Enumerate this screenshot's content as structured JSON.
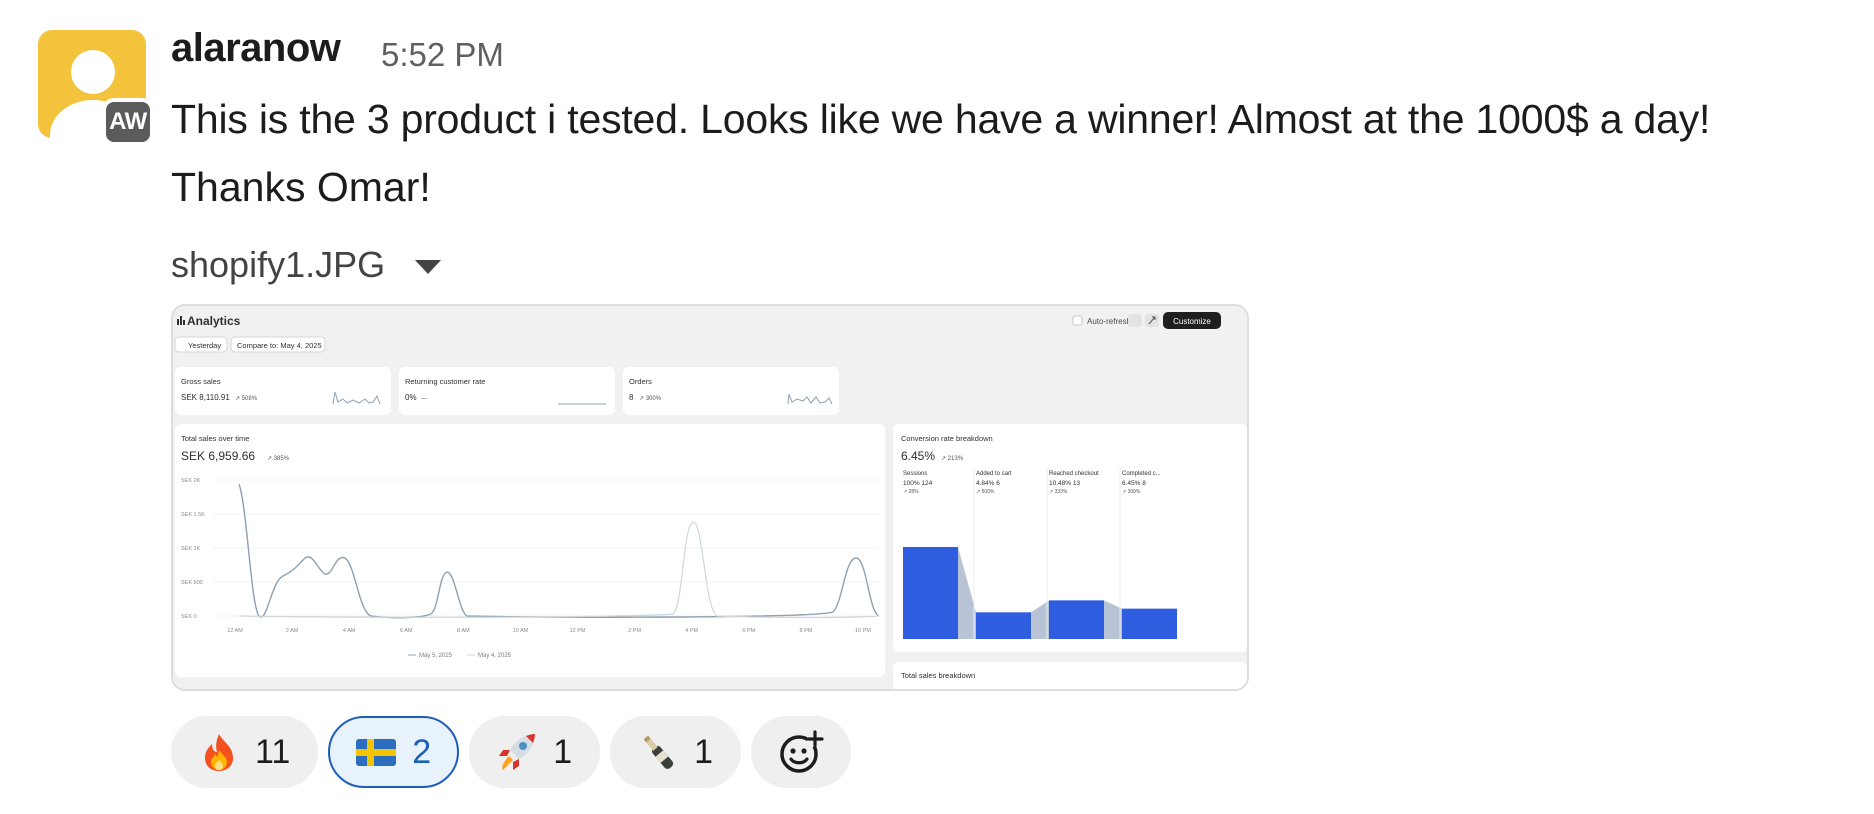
{
  "message": {
    "author": "alaranow",
    "avatar_badge": "AW",
    "timestamp": "5:52 PM",
    "text_line1": "This is the 3 product i tested. Looks like we have a winner! Almost at the 1000$ a day!",
    "text_line2": "Thanks Omar!"
  },
  "attachment": {
    "file_name": "shopify1.JPG",
    "dashboard": {
      "title": "Analytics",
      "auto_refresh": "Auto-refresh",
      "customize": "Customize",
      "date_chip": "Yesterday",
      "compare_chip": "Compare to: May 4, 2025",
      "metrics": [
        {
          "label": "Gross sales",
          "value": "SEK 8,110.91",
          "change": "↗ 508%"
        },
        {
          "label": "Returning customer rate",
          "value": "0%",
          "change": "—"
        },
        {
          "label": "Orders",
          "value": "8",
          "change": "↗ 300%"
        }
      ],
      "total_sales": {
        "title": "Total sales over time",
        "value": "SEK 6,959.66",
        "change": "↗ 385%",
        "y_ticks": [
          "SEK 2K",
          "SEK 1.5K",
          "SEK 1K",
          "SEK 500",
          "SEK 0"
        ],
        "x_ticks": [
          "12 AM",
          "2 AM",
          "4 AM",
          "6 AM",
          "8 AM",
          "10 AM",
          "12 PM",
          "2 PM",
          "4 PM",
          "6 PM",
          "8 PM",
          "10 PM"
        ],
        "legend": [
          "May 5, 2025",
          "May 4, 2025"
        ]
      },
      "conversion": {
        "title": "Conversion rate breakdown",
        "value": "6.45%",
        "change": "↗ 213%",
        "steps": [
          {
            "label": "Sessions",
            "pct": "100%",
            "count": "124",
            "change": "↗ 28%",
            "level": 1.0
          },
          {
            "label": "Added to cart",
            "pct": "4.84%",
            "count": "6",
            "change": "↗ 500%",
            "level": 0.29
          },
          {
            "label": "Reached checkout",
            "pct": "10.48%",
            "count": "13",
            "change": "↗ 333%",
            "level": 0.42
          },
          {
            "label": "Completed c...",
            "pct": "6.45%",
            "count": "8",
            "change": "↗ 300%",
            "level": 0.33
          }
        ]
      },
      "total_sales_breakdown": "Total sales breakdown"
    }
  },
  "reactions": [
    {
      "emoji": "fire-icon",
      "count": "11",
      "active": false
    },
    {
      "emoji": "sweden-flag-icon",
      "count": "2",
      "active": true
    },
    {
      "emoji": "rocket-icon",
      "count": "1",
      "active": false
    },
    {
      "emoji": "champagne-icon",
      "count": "1",
      "active": false
    }
  ],
  "colors": {
    "accent_blue": "#1d5fb8",
    "bar_blue": "#2f5de0",
    "avatar_yellow": "#f3c33c"
  }
}
